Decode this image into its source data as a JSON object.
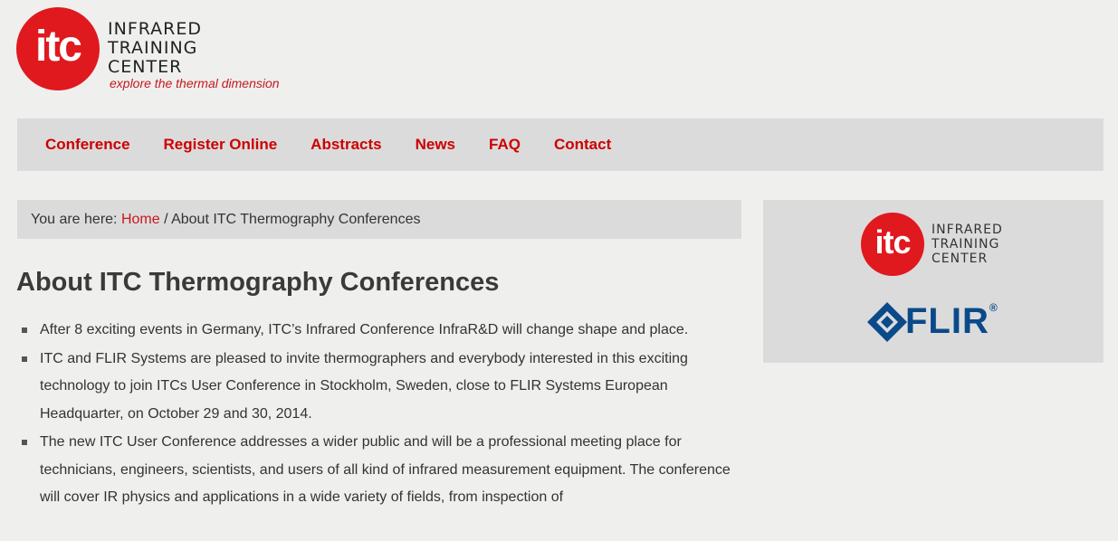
{
  "header": {
    "logo_mark": "itc",
    "logo_lines": [
      "INFRARED",
      "TRAINING",
      "CENTER"
    ],
    "tagline": "explore the thermal dimension"
  },
  "nav": {
    "items": [
      "Conference",
      "Register Online",
      "Abstracts",
      "News",
      "FAQ",
      "Contact"
    ]
  },
  "breadcrumb": {
    "prefix": "You are here: ",
    "home": "Home",
    "separator": " / ",
    "current": "About ITC Thermography Conferences"
  },
  "main": {
    "title": "About ITC Thermography Conferences",
    "bullets": [
      "After 8 exciting events in Germany, ITC’s Infrared Conference InfraR&D will change shape and place.",
      "ITC and FLIR Systems are pleased to invite thermographers and everybody interested in this exciting technology to join ITCs User Conference in Stockholm, Sweden, close to FLIR Systems European Headquarter, on October 29 and 30, 2014.",
      "The new ITC User Conference addresses a wider public and will be a professional meeting place for technicians, engineers, scientists, and users of all kind of infrared measurement equipment. The conference will cover IR physics and applications in a wide variety of fields, from inspection of"
    ]
  },
  "sidebar": {
    "itc_mark": "itc",
    "itc_lines": [
      "INFRARED",
      "TRAINING",
      "CENTER"
    ],
    "flir_text": "FLIR",
    "flir_reg": "®"
  },
  "colors": {
    "brand_red": "#e0191f",
    "nav_text": "#cc0000",
    "flir_blue": "#0a4a8a",
    "panel_bg": "#dcdbdb",
    "page_bg": "#efefee"
  }
}
